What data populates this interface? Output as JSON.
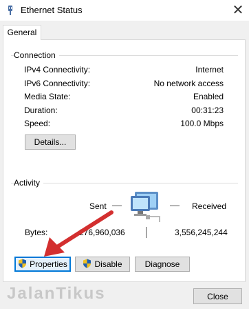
{
  "window": {
    "title": "Ethernet Status",
    "close_glyph": "✕"
  },
  "tabs": [
    {
      "label": "General"
    }
  ],
  "connection": {
    "group_label": "Connection",
    "rows": [
      {
        "label": "IPv4 Connectivity:",
        "value": "Internet"
      },
      {
        "label": "IPv6 Connectivity:",
        "value": "No network access"
      },
      {
        "label": "Media State:",
        "value": "Enabled"
      },
      {
        "label": "Duration:",
        "value": "00:31:23"
      },
      {
        "label": "Speed:",
        "value": "100.0 Mbps"
      }
    ],
    "details_button": "Details..."
  },
  "activity": {
    "group_label": "Activity",
    "sent_label": "Sent",
    "received_label": "Received",
    "bytes_label": "Bytes:",
    "sent_bytes": "276,960,036",
    "received_bytes": "3,556,245,244"
  },
  "buttons": {
    "properties": "Properties",
    "disable": "Disable",
    "diagnose": "Diagnose",
    "close": "Close"
  },
  "watermark": "JalanTikus",
  "colors": {
    "accent": "#0078d7",
    "arrow": "#d32f2f"
  }
}
